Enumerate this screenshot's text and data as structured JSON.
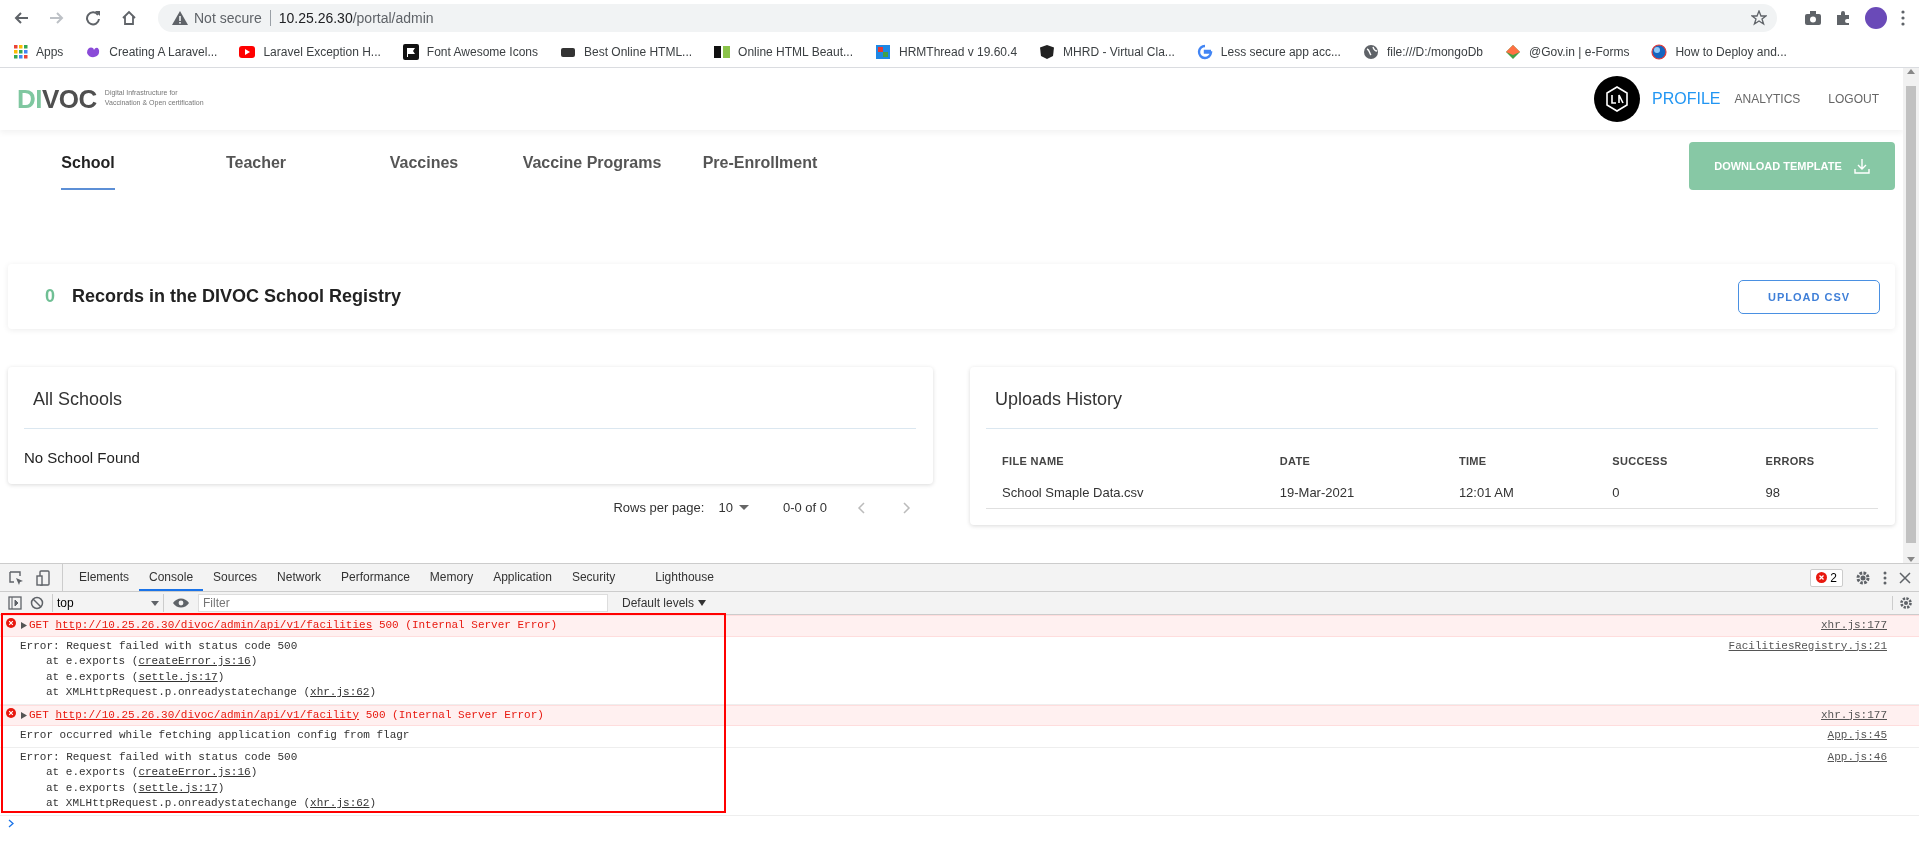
{
  "browser": {
    "address": {
      "security": "Not secure",
      "host": "10.25.26.30",
      "path": "/portal/admin"
    },
    "bookmarks": [
      {
        "label": "Apps"
      },
      {
        "label": "Creating A Laravel..."
      },
      {
        "label": "Laravel Exception H..."
      },
      {
        "label": "Font Awesome Icons"
      },
      {
        "label": "Best Online HTML..."
      },
      {
        "label": "Online HTML Beaut..."
      },
      {
        "label": "HRMThread v 19.60.4"
      },
      {
        "label": "MHRD - Virtual Cla..."
      },
      {
        "label": "Less secure app acc..."
      },
      {
        "label": "file:///D:/mongoDb"
      },
      {
        "label": "@Gov.in | e-Forms"
      },
      {
        "label": "How to Deploy and..."
      }
    ]
  },
  "header": {
    "logo": {
      "accent": "DI",
      "rest": "VOC",
      "tagline": [
        "Digital Infrastructure for",
        "Vaccination & Open certification"
      ]
    },
    "nav": [
      {
        "label": "PROFILE",
        "selected": true
      },
      {
        "label": "ANALYTICS",
        "selected": false
      },
      {
        "label": "LOGOUT",
        "selected": false
      }
    ]
  },
  "tabs": [
    {
      "label": "School",
      "selected": true
    },
    {
      "label": "Teacher",
      "selected": false
    },
    {
      "label": "Vaccines",
      "selected": false
    },
    {
      "label": "Vaccine Programs",
      "selected": false
    },
    {
      "label": "Pre-Enrollment",
      "selected": false
    }
  ],
  "download_button": "DOWNLOAD TEMPLATE",
  "summary": {
    "count": "0",
    "text": "Records in the DIVOC School Registry",
    "upload_button": "UPLOAD CSV"
  },
  "schools_card": {
    "title": "All Schools",
    "empty": "No School Found",
    "pagination": {
      "rows_label": "Rows per page:",
      "rows_value": "10",
      "range": "0-0 of 0"
    }
  },
  "uploads_card": {
    "title": "Uploads History",
    "columns": [
      "FILE NAME",
      "DATE",
      "TIME",
      "SUCCESS",
      "ERRORS"
    ],
    "rows": [
      [
        "School Smaple Data.csv",
        "19-Mar-2021",
        "12:01 AM",
        "0",
        "98"
      ]
    ]
  },
  "devtools": {
    "tabs": [
      {
        "label": "Elements",
        "selected": false
      },
      {
        "label": "Console",
        "selected": true
      },
      {
        "label": "Sources",
        "selected": false
      },
      {
        "label": "Network",
        "selected": false
      },
      {
        "label": "Performance",
        "selected": false
      },
      {
        "label": "Memory",
        "selected": false
      },
      {
        "label": "Application",
        "selected": false
      },
      {
        "label": "Security",
        "selected": false
      },
      {
        "label": "Lighthouse",
        "selected": false
      }
    ],
    "error_count": "2",
    "context": "top",
    "filter_placeholder": "Filter",
    "levels": "Default levels",
    "messages": [
      {
        "kind": "error",
        "method": "GET",
        "url": "http://10.25.26.30/divoc/admin/api/v1/facilities",
        "status": "500 (Internal Server Error)",
        "source": "xhr.js:177"
      },
      {
        "kind": "stack",
        "text": "Error: Request failed with status code 500",
        "frames": [
          {
            "before": "at e.exports (",
            "link": "createError.js:16",
            "after": ")"
          },
          {
            "before": "at e.exports (",
            "link": "settle.js:17",
            "after": ")"
          },
          {
            "before": "at XMLHttpRequest.p.onreadystatechange (",
            "link": "xhr.js:62",
            "after": ")"
          }
        ],
        "source": "FacilitiesRegistry.js:21"
      },
      {
        "kind": "error",
        "method": "GET",
        "url": "http://10.25.26.30/divoc/admin/api/v1/facility",
        "status": "500 (Internal Server Error)",
        "source": "xhr.js:177"
      },
      {
        "kind": "text",
        "text": "Error occurred while fetching application config from flagr",
        "source": "App.js:45"
      },
      {
        "kind": "stack",
        "text": "Error: Request failed with status code 500",
        "frames": [
          {
            "before": "at e.exports (",
            "link": "createError.js:16",
            "after": ")"
          },
          {
            "before": "at e.exports (",
            "link": "settle.js:17",
            "after": ")"
          },
          {
            "before": "at XMLHttpRequest.p.onreadystatechange (",
            "link": "xhr.js:62",
            "after": ")"
          }
        ],
        "source": "App.js:46"
      }
    ]
  }
}
